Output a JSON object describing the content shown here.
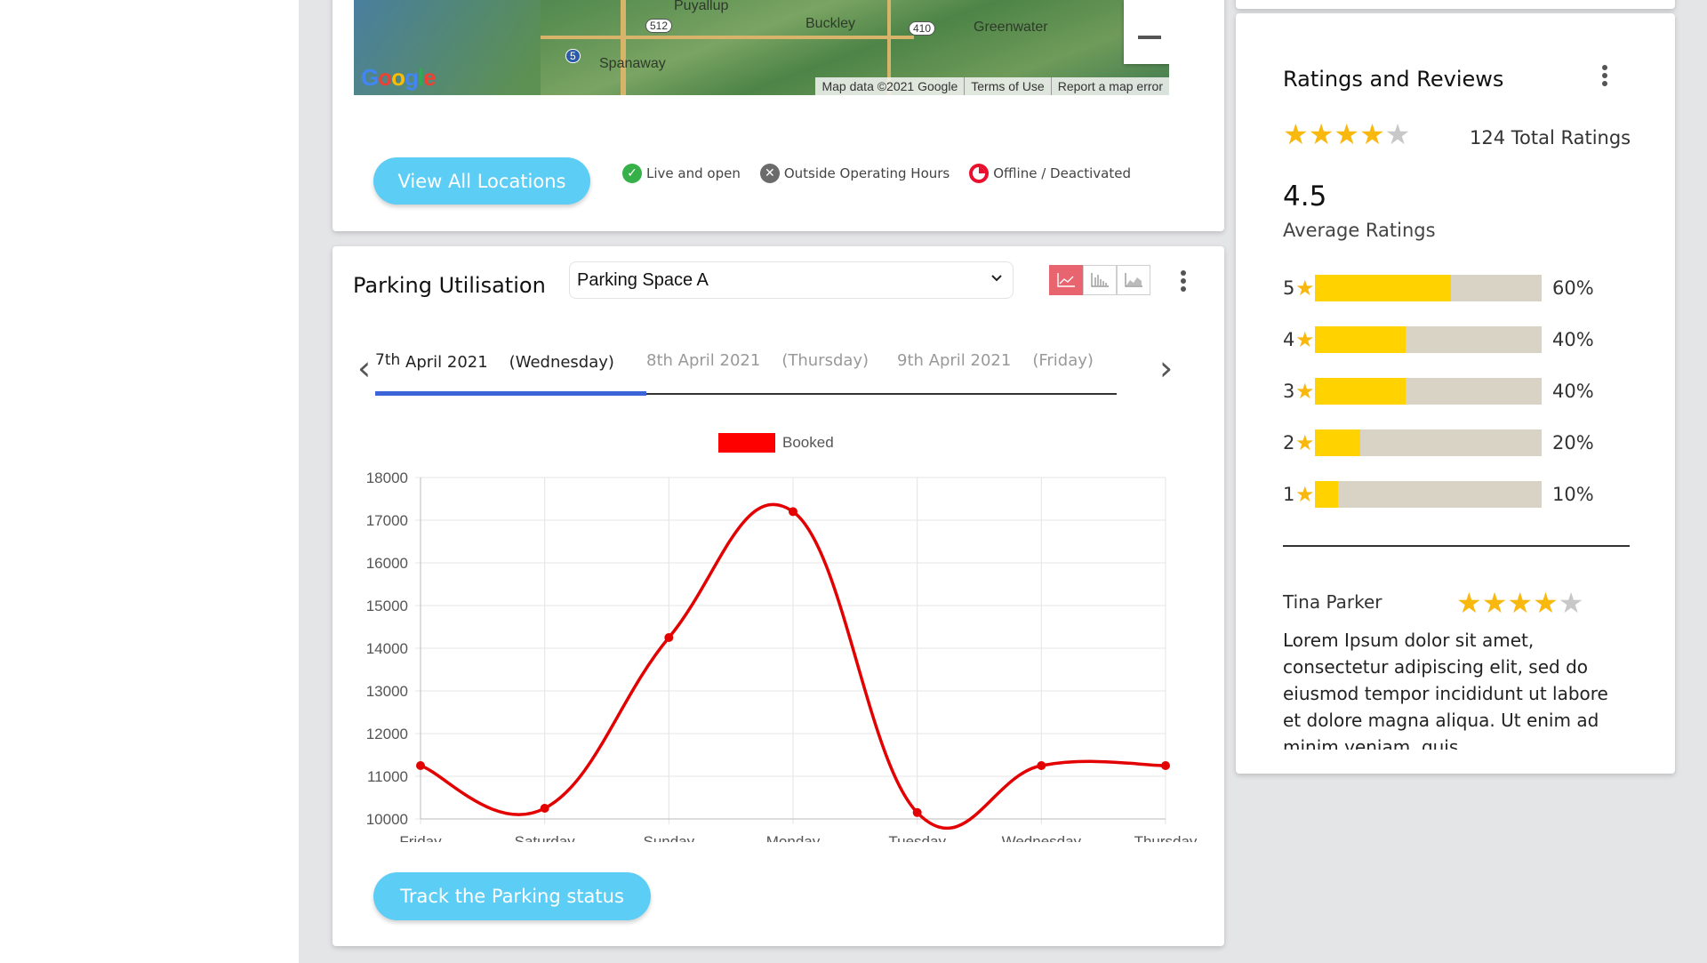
{
  "map": {
    "places": [
      "Puyallup",
      "Buckley",
      "Greenwater",
      "Spanaway"
    ],
    "shields": [
      "512",
      "410",
      "5"
    ],
    "google_logo": "Google",
    "attribution": [
      "Map data ©2021 Google",
      "Terms of Use",
      "Report a map error"
    ]
  },
  "locations": {
    "view_all_label": "View All Locations",
    "legend": [
      {
        "label": "Live and open",
        "color": "#36b14a",
        "icon": "check-icon"
      },
      {
        "label": "Outside Operating Hours",
        "color": "#6b6b6b",
        "icon": "x-icon"
      },
      {
        "label": "Offline / Deactivated",
        "color": "#e8102c",
        "icon": "clock-icon"
      }
    ]
  },
  "parking": {
    "title": "Parking Utilisation",
    "selected_space": "Parking Space A",
    "dates": [
      {
        "day_num": "7th",
        "month_year": "April 2021",
        "weekday": "(Wednesday)",
        "active": true
      },
      {
        "day_num": "8th",
        "month_year": "April 2021",
        "weekday": "(Thursday)",
        "active": false
      },
      {
        "day_num": "9th",
        "month_year": "April 2021",
        "weekday": "(Friday)",
        "active": false
      }
    ],
    "track_label": "Track the Parking status"
  },
  "chart_data": {
    "type": "line",
    "categories": [
      "Friday",
      "Saturday",
      "Sunday",
      "Monday",
      "Tuesday",
      "Wednesday",
      "Thursday"
    ],
    "series": [
      {
        "name": "Booked",
        "values": [
          11250,
          10250,
          14250,
          17200,
          10150,
          11250,
          11250
        ],
        "color": "#e30000"
      }
    ],
    "ylim": [
      10000,
      18000
    ],
    "yticks": [
      18000,
      17000,
      16000,
      15000,
      14000,
      13000,
      12000,
      11000,
      10000
    ],
    "grid": true,
    "legend": "top-center",
    "title": "",
    "xlabel": "",
    "ylabel": ""
  },
  "ratings": {
    "title": "Ratings and Reviews",
    "stars_filled": 4,
    "stars_total": 5,
    "total_label": "124 Total Ratings",
    "average_value": "4.5",
    "average_label": "Average Ratings",
    "breakdown": [
      {
        "stars": "5",
        "fraction": 0.6,
        "pct": "60%"
      },
      {
        "stars": "4",
        "fraction": 0.4,
        "pct": "40%"
      },
      {
        "stars": "3",
        "fraction": 0.4,
        "pct": "40%"
      },
      {
        "stars": "2",
        "fraction": 0.2,
        "pct": "20%"
      },
      {
        "stars": "1",
        "fraction": 0.1,
        "pct": "10%"
      }
    ],
    "review": {
      "name": "Tina Parker",
      "stars_filled": 4,
      "text": "Lorem Ipsum dolor sit amet, consectetur adipiscing elit, sed do eiusmod tempor incididunt ut labore et dolore magna aliqua. Ut enim ad minim veniam, quis"
    }
  },
  "colors": {
    "accent_button": "#5ccdf5",
    "chart_line": "#e30000",
    "bar_fill": "#ffd200",
    "bar_track": "#d9d3c6",
    "star": "#f8b80e",
    "active_tab": "#3a64d8"
  }
}
